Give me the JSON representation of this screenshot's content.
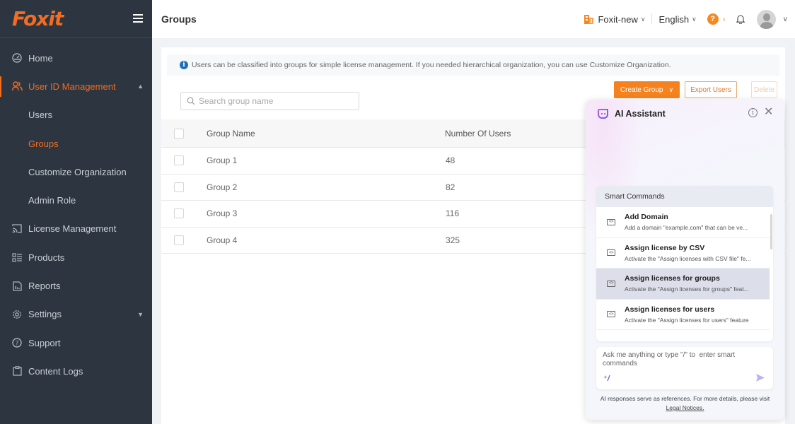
{
  "brand": {
    "logo_text": "Foxit",
    "accent": "#f26c21"
  },
  "sidebar": {
    "items": [
      {
        "label": "Home",
        "icon": "dashboard-icon"
      },
      {
        "label": "User ID Management",
        "icon": "users-icon",
        "expanded": true
      },
      {
        "label": "Users"
      },
      {
        "label": "Groups",
        "active": true
      },
      {
        "label": "Customize Organization"
      },
      {
        "label": "Admin Role"
      },
      {
        "label": "License Management",
        "icon": "cast-icon"
      },
      {
        "label": "Products",
        "icon": "list-icon"
      },
      {
        "label": "Reports",
        "icon": "report-icon"
      },
      {
        "label": "Settings",
        "icon": "gear-icon"
      },
      {
        "label": "Support",
        "icon": "question-circle-icon"
      },
      {
        "label": "Content Logs",
        "icon": "clipboard-icon"
      }
    ]
  },
  "header": {
    "title": "Groups",
    "org": "Foxit-new",
    "language": "English",
    "help": "?"
  },
  "main": {
    "info_text": "Users can be classified into groups for simple license management. If you needed hierarchical organization, you can use Customize Organization.",
    "buttons": {
      "create": "Create Group",
      "export": "Export Users",
      "delete": "Delete"
    },
    "search_placeholder": "Search group name",
    "table": {
      "columns": [
        "Group Name",
        "Number Of Users"
      ],
      "rows": [
        {
          "name": "Group 1",
          "users": "48"
        },
        {
          "name": "Group 2",
          "users": "82"
        },
        {
          "name": "Group 3",
          "users": "116"
        },
        {
          "name": "Group 4",
          "users": "325"
        }
      ]
    }
  },
  "ai_assistant": {
    "title": "AI Assistant",
    "smart_commands_title": "Smart Commands",
    "commands": [
      {
        "title": "Add Domain",
        "desc": "Add a domain \"example.com\" that can be ve..."
      },
      {
        "title": "Assign license by CSV",
        "desc": "Activate the \"Assign licenses with CSV file\" fe..."
      },
      {
        "title": "Assign licenses for groups",
        "desc": "Activate the \"Assign licenses for groups\" feat...",
        "highlighted": true
      },
      {
        "title": "Assign licenses for users",
        "desc": "Activate the \"Assign licenses for users\" feature"
      }
    ],
    "input_placeholder": "Ask me anything or type \"/\" to  enter smart commands",
    "slash_label": "⁺/",
    "footer_text": "AI responses serve as references. For more details, please visit",
    "footer_link": "Legal Notices."
  }
}
